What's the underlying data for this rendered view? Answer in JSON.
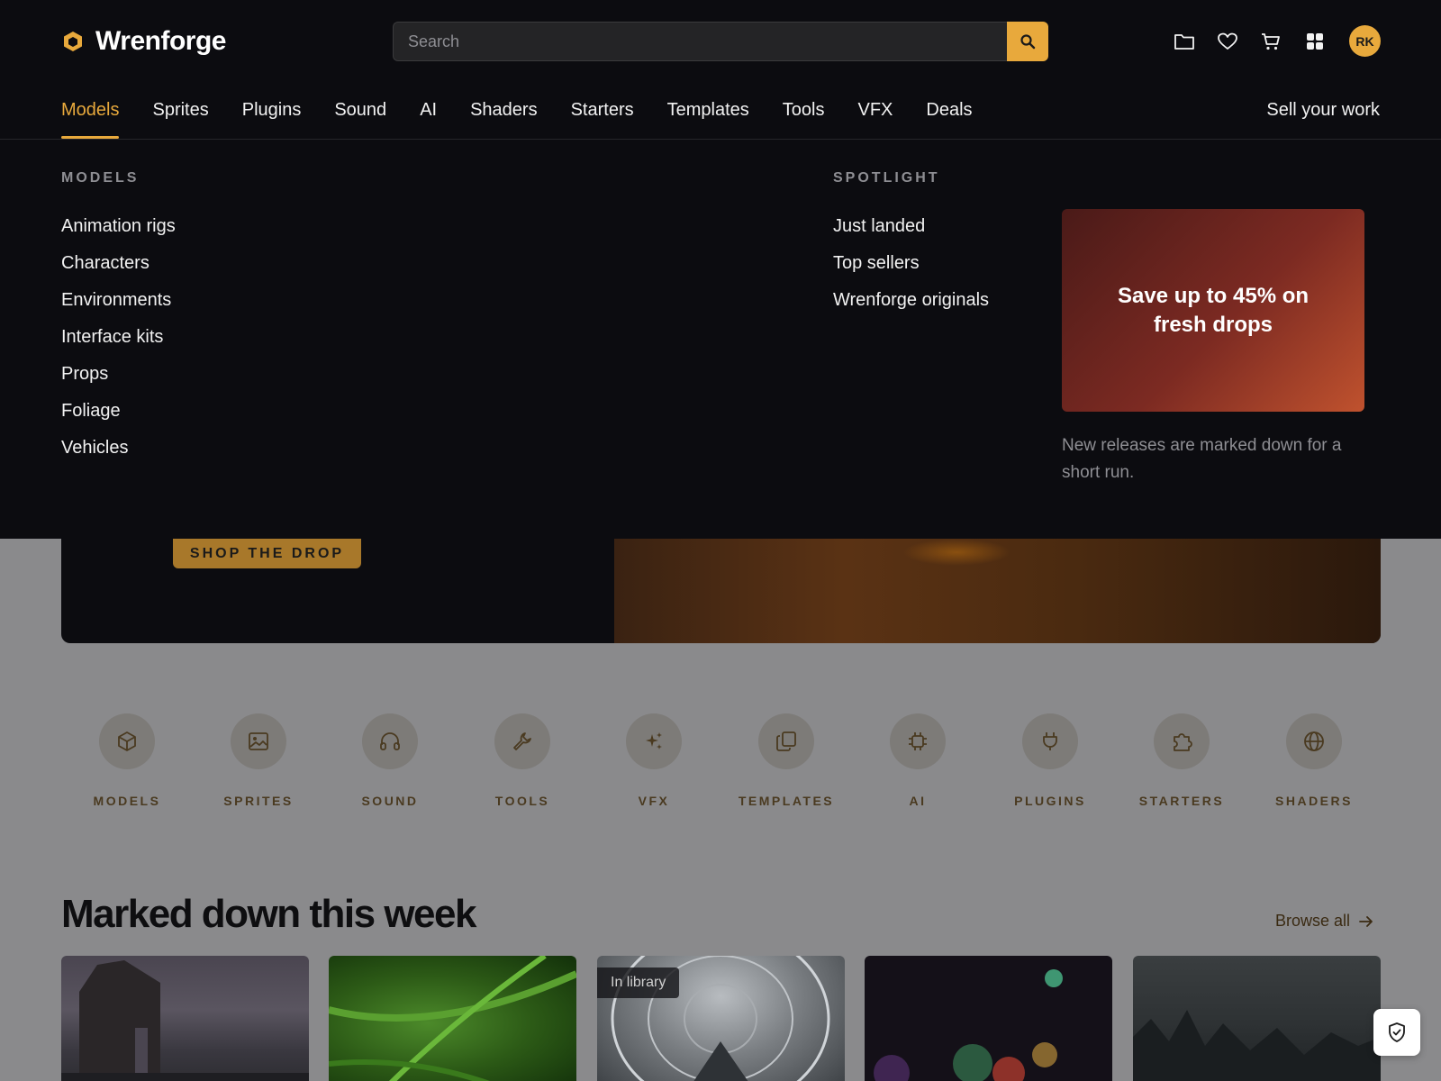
{
  "brand": {
    "name": "Wrenforge",
    "accent": "#e8a93c",
    "icon": "hexagon-logo-icon"
  },
  "search": {
    "placeholder": "Search",
    "value": ""
  },
  "header_icons": [
    "folder-icon",
    "heart-icon",
    "cart-icon",
    "grid-icon"
  ],
  "user": {
    "initials": "RK"
  },
  "nav": {
    "items": [
      "Models",
      "Sprites",
      "Plugins",
      "Sound",
      "AI",
      "Shaders",
      "Starters",
      "Templates",
      "Tools",
      "VFX",
      "Deals"
    ],
    "active": "Models",
    "sell_label": "Sell your work"
  },
  "mega_menu": {
    "models_heading": "MODELS",
    "models_links": [
      "Animation rigs",
      "Characters",
      "Environments",
      "Interface kits",
      "Props",
      "Foliage",
      "Vehicles"
    ],
    "spotlight_heading": "SPOTLIGHT",
    "spotlight_links": [
      "Just landed",
      "Top sellers",
      "Wrenforge originals"
    ],
    "promo_title": "Save up to 45% on fresh drops",
    "promo_note": "New releases are marked down for a short run."
  },
  "hero": {
    "cta_label": "SHOP THE DROP"
  },
  "categories": [
    {
      "label": "MODELS",
      "icon": "cube-icon"
    },
    {
      "label": "SPRITES",
      "icon": "image-icon"
    },
    {
      "label": "SOUND",
      "icon": "headphones-icon"
    },
    {
      "label": "TOOLS",
      "icon": "wrench-icon"
    },
    {
      "label": "VFX",
      "icon": "sparkles-icon"
    },
    {
      "label": "TEMPLATES",
      "icon": "copy-icon"
    },
    {
      "label": "AI",
      "icon": "chip-icon"
    },
    {
      "label": "PLUGINS",
      "icon": "plug-icon"
    },
    {
      "label": "STARTERS",
      "icon": "puzzle-icon"
    },
    {
      "label": "SHADERS",
      "icon": "globe-icon"
    }
  ],
  "section": {
    "title": "Marked down this week",
    "browse_label": "Browse all",
    "cards": [
      {
        "badge": ""
      },
      {
        "badge": ""
      },
      {
        "badge": "In library"
      },
      {
        "badge": ""
      },
      {
        "badge": ""
      }
    ]
  },
  "fab": {
    "icon": "shield-check-icon"
  }
}
